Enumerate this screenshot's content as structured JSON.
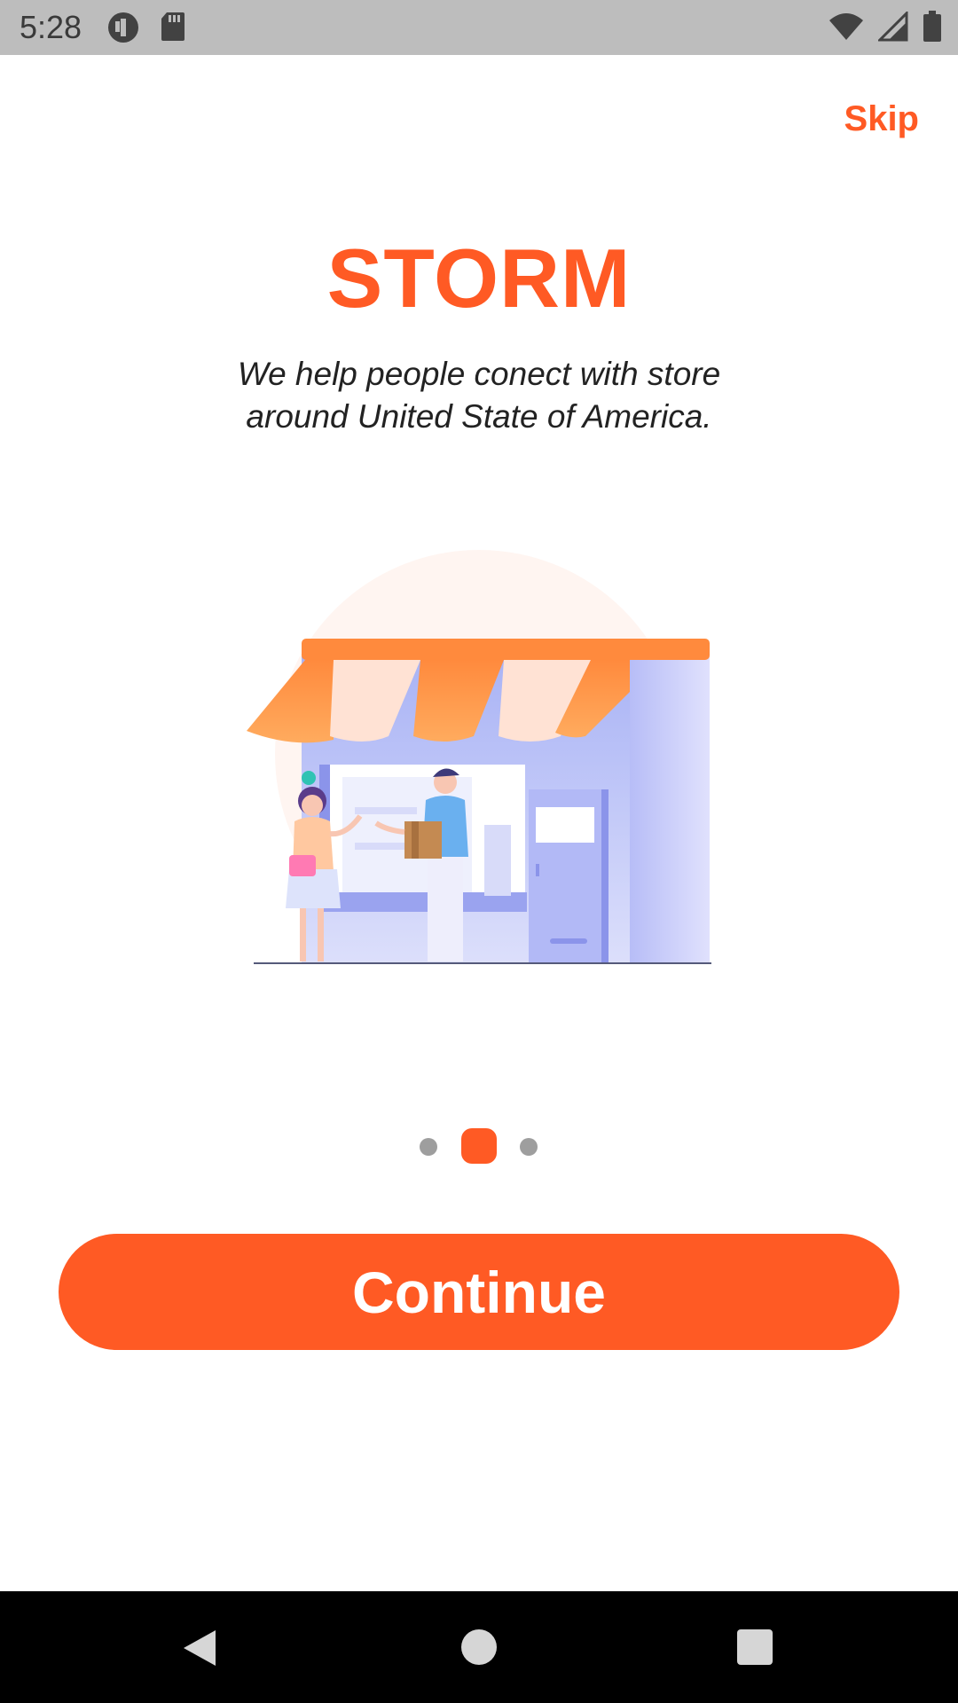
{
  "status_bar": {
    "time": "5:28",
    "left_icons": [
      "circle-app-icon",
      "sd-card-icon"
    ],
    "right_icons": [
      "wifi-icon",
      "signal-icon",
      "battery-icon"
    ]
  },
  "header": {
    "skip_label": "Skip"
  },
  "onboarding": {
    "title": "STORM",
    "tagline_line1": "We help people conect with store",
    "tagline_line2": "around United State of America.",
    "illustration": "storefront-illustration",
    "page_indicator": {
      "total": 3,
      "active": 2
    }
  },
  "actions": {
    "continue_label": "Continue"
  },
  "nav_bar": {
    "buttons": [
      "back-icon",
      "home-icon",
      "recents-icon"
    ]
  },
  "colors": {
    "accent": "#ff5a24",
    "status_bar": "#bdbdbd",
    "nav_bar": "#000000"
  }
}
